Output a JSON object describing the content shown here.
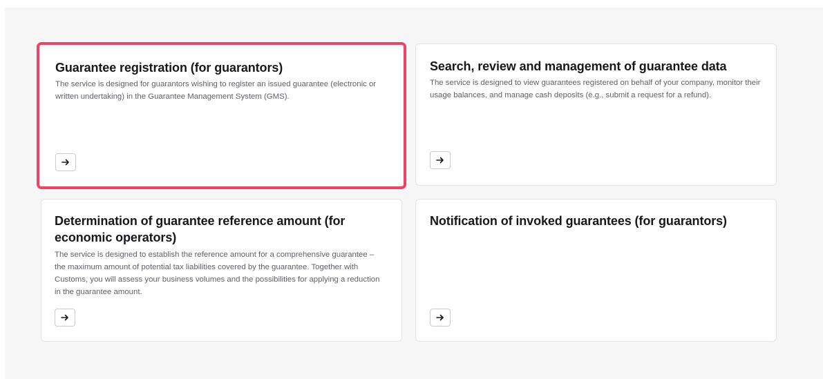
{
  "cards": [
    {
      "title": "Guarantee registration (for guarantors)",
      "description": "The service is designed for guarantors wishing to register an issued guarantee (electronic or written undertaking) in the Guarantee Management System (GMS).",
      "button_icon": "arrow-right-icon",
      "selected": true
    },
    {
      "title": "Search, review and management of guarantee data",
      "description": "The service is designed to view guarantees registered on behalf of your company, monitor their usage balances, and manage cash deposits (e.g., submit a request for a refund).",
      "button_icon": "arrow-right-icon",
      "selected": false
    },
    {
      "title": "Determination of guarantee reference amount (for economic operators)",
      "description": "The service is designed to establish the reference amount for a comprehensive guarantee – the maximum amount of potential tax liabilities covered by the guarantee. Together with Customs, you will assess your business volumes and the possibilities for applying a reduction in the guarantee amount.",
      "button_icon": "arrow-right-icon",
      "selected": false
    },
    {
      "title": "Notification of invoked guarantees (for guarantors)",
      "description": "",
      "button_icon": "arrow-right-icon",
      "selected": false
    }
  ],
  "colors": {
    "page_background": "#f6f6f7",
    "card_background": "#ffffff",
    "card_border": "#e3e4e8",
    "selected_border": "#ef4267",
    "title_text": "#17181b",
    "description_text": "#5f6168"
  }
}
